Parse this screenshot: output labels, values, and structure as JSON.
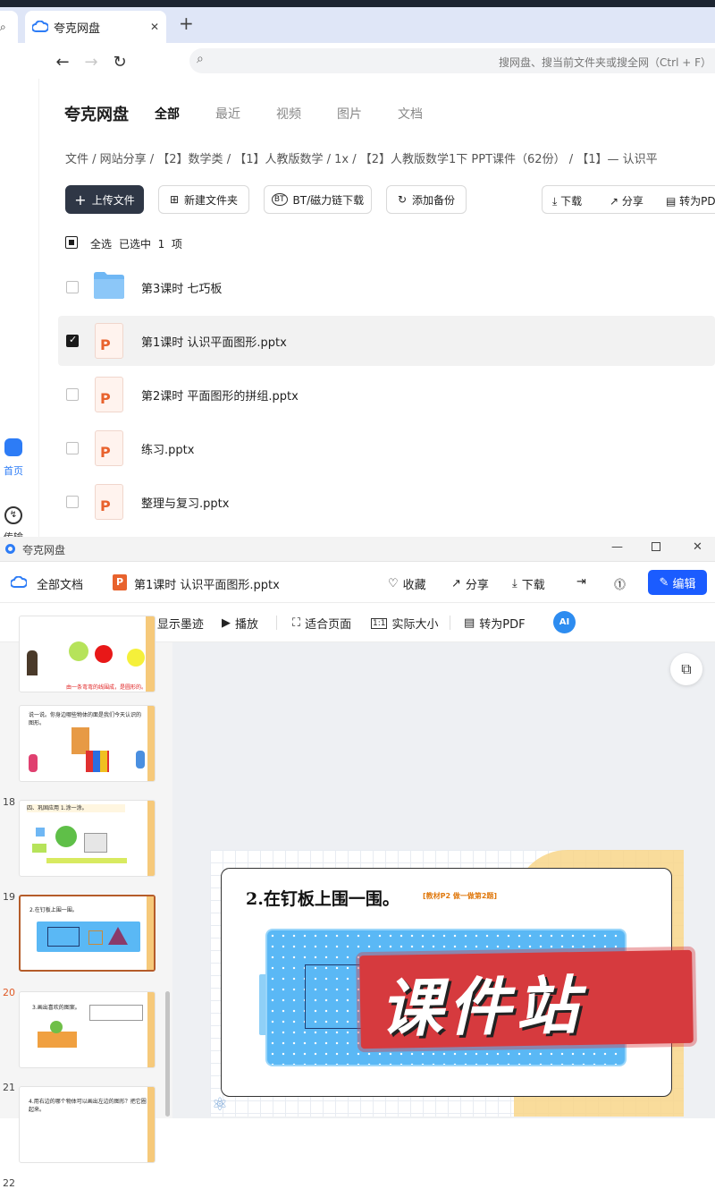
{
  "browser": {
    "tab_title": "夸克网盘",
    "new_tab_symbol": "+",
    "close_symbol": "✕",
    "search_placeholder": "搜网盘、搜当前文件夹或搜全网（Ctrl + F）"
  },
  "drive": {
    "logo": "夸克网盘",
    "nav_tabs": [
      "全部",
      "最近",
      "视频",
      "图片",
      "文档"
    ],
    "breadcrumb": "文件 / 网站分享 / 【2】数学类 / 【1】人教版数学 / 1x / 【2】人教版数学1下 PPT课件（62份） / 【1】— 认识平",
    "left_rail": {
      "home_label": "首页",
      "transfer_label": "传输"
    },
    "toolbar": {
      "upload": "上传文件",
      "new_folder": "新建文件夹",
      "bt_download": "BT/磁力链下载",
      "add_backup": "添加备份",
      "download": "下载",
      "share": "分享",
      "to_pdf": "转为PDF"
    },
    "select_all": "全选",
    "selected_text": "已选中  1  项",
    "files": [
      {
        "name": "第3课时 七巧板",
        "type": "folder",
        "checked": false
      },
      {
        "name": "第1课时 认识平面图形.pptx",
        "type": "pptx",
        "checked": true
      },
      {
        "name": "第2课时 平面图形的拼组.pptx",
        "type": "pptx",
        "checked": false
      },
      {
        "name": "练习.pptx",
        "type": "pptx",
        "checked": false
      },
      {
        "name": "整理与复习.pptx",
        "type": "pptx",
        "checked": false
      }
    ]
  },
  "viewer": {
    "window_title": "夸克网盘",
    "all_docs": "全部文档",
    "file_name": "第1课时 认识平面图形.pptx",
    "favorite": "收藏",
    "share": "分享",
    "download": "下载",
    "edit": "编辑",
    "show_ink": "显示墨迹",
    "play": "播放",
    "fit_page": "适合页面",
    "actual_size": "实际大小",
    "to_pdf": "转为PDF",
    "ai_label": "AI",
    "thumbnails": [
      {
        "num": "",
        "caption": "由一条弯弯的线围成，是圆形的。"
      },
      {
        "num": "18",
        "caption": "说一说。你身边哪些物体的面是我们今天认识的图形。"
      },
      {
        "num": "19",
        "caption": "四、巩固应用  1.涂一涂。"
      },
      {
        "num": "20",
        "caption": "2.在钉板上围一围。",
        "selected": true
      },
      {
        "num": "21",
        "caption": "3.画出喜欢的图案。"
      },
      {
        "num": "22",
        "caption": "4.用右边的哪个物体可以画出左边的图形？把它圈起来。"
      }
    ],
    "slide": {
      "title": "2.在钉板上围一围。",
      "subtitle": "[教材P2 做一做第2题]",
      "watermark": "课件站"
    },
    "colors": {
      "accent": "#1b5cff",
      "board": "#5ab8f5",
      "shape_rect": "#1f3a6e",
      "shape_square": "#c98a3a",
      "shape_triangle": "#8a3a6a"
    }
  }
}
